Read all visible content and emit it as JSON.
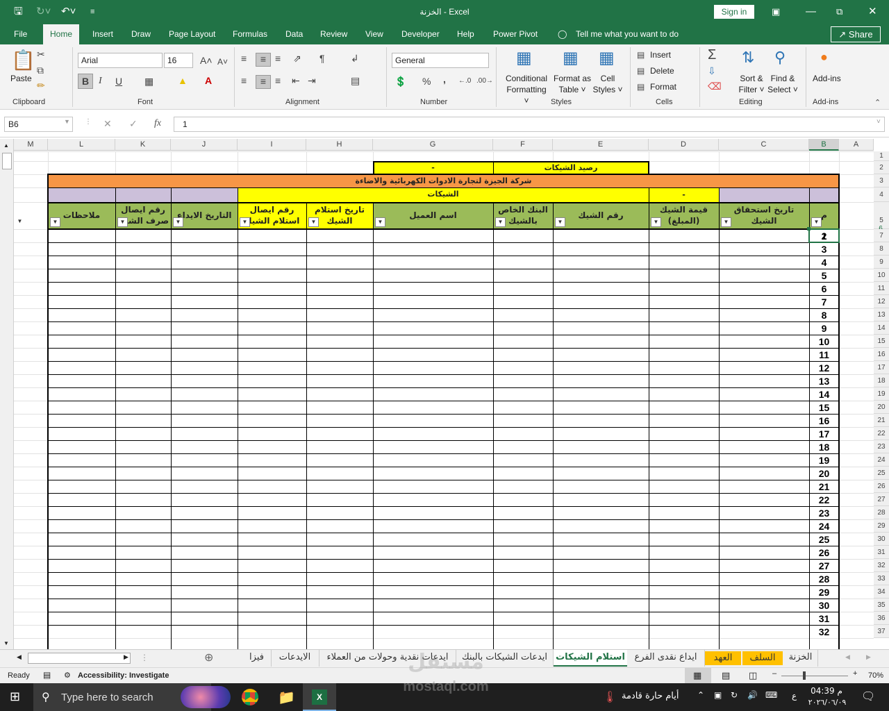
{
  "window": {
    "title": "الخزنة - Excel",
    "sign_in": "Sign in"
  },
  "menu": {
    "tabs": [
      "File",
      "Home",
      "Insert",
      "Draw",
      "Page Layout",
      "Formulas",
      "Data",
      "Review",
      "View",
      "Developer",
      "Help",
      "Power Pivot"
    ],
    "tell_me": "Tell me what you want to do",
    "share": "Share"
  },
  "ribbon": {
    "clipboard": {
      "paste": "Paste",
      "label": "Clipboard"
    },
    "font": {
      "name": "Arial",
      "size": "16",
      "bold": "B",
      "italic": "I",
      "underline": "U",
      "label": "Font"
    },
    "alignment": {
      "label": "Alignment"
    },
    "number": {
      "format": "General",
      "percent": "%",
      "comma": ",",
      "label": "Number"
    },
    "styles": {
      "conditional": [
        "Conditional",
        "Formatting ˅"
      ],
      "format_table": [
        "Format as",
        "Table ˅"
      ],
      "cell_styles": [
        "Cell",
        "Styles ˅"
      ],
      "label": "Styles"
    },
    "cells": {
      "insert": "Insert",
      "delete": "Delete",
      "format": "Format",
      "label": "Cells"
    },
    "editing": {
      "sort": [
        "Sort &",
        "Filter ˅"
      ],
      "find": [
        "Find &",
        "Select ˅"
      ],
      "label": "Editing"
    },
    "addins": {
      "button": "Add-ins",
      "label": "Add-ins"
    }
  },
  "formula_bar": {
    "name_box": "B6",
    "fx": "fx",
    "value": "1"
  },
  "columns": [
    "M",
    "L",
    "K",
    "J",
    "I",
    "H",
    "G",
    "F",
    "E",
    "D",
    "C",
    "B",
    "A"
  ],
  "rows": [
    "1",
    "2",
    "3",
    "4",
    "5",
    "6",
    "7",
    "8",
    "9",
    "10",
    "11",
    "12",
    "13",
    "14",
    "15",
    "16",
    "17",
    "18",
    "19",
    "20",
    "21",
    "22",
    "23",
    "24",
    "25",
    "26",
    "27",
    "28",
    "29",
    "30",
    "31",
    "32",
    "33",
    "34",
    "35",
    "36",
    "37"
  ],
  "sheet": {
    "balance_label": "رصيد الشيكات",
    "balance_value": "-",
    "company": "شركة الجيزة لتجارة الادوات الكهربائية والاضاءة",
    "cheques_title": "الشيكات",
    "total_dash": "-",
    "headers": {
      "b": "م",
      "c": "تاريخ استحقاق الشيك",
      "d": "قيمة الشيك (المبلغ)",
      "e": "رقم الشيك",
      "f": "البنك الخاص بالشيك",
      "g": "اسم العميل",
      "h": "تاريخ استلام الشيك",
      "i": "رقم ايصال استلام الشيك",
      "j": "التاريخ الايداع",
      "k": "رقم ايصال صرف الشيك",
      "l": "ملاحظات"
    },
    "row_numbers": [
      "1",
      "2",
      "3",
      "4",
      "5",
      "6",
      "7",
      "8",
      "9",
      "10",
      "11",
      "12",
      "13",
      "14",
      "15",
      "16",
      "17",
      "18",
      "19",
      "20",
      "21",
      "22",
      "23",
      "24",
      "25",
      "26",
      "27",
      "28",
      "29",
      "30",
      "31",
      "32"
    ]
  },
  "sheet_tabs": [
    "الخزنة",
    "السلف",
    "العهد",
    "ايداع نقدى الفرع",
    "استلام الشيكات",
    "ايدعات الشيكات بالبنك",
    "ايدعات نقدية وحولات من العملاء",
    "الايدعات",
    "فيزا"
  ],
  "active_sheet": "استلام الشيكات",
  "status": {
    "ready": "Ready",
    "accessibility": "Accessibility: Investigate",
    "zoom": "70%"
  },
  "taskbar": {
    "search": "Type here to search",
    "weather": "أيام حارة قادمة",
    "time": "04:39 م",
    "date": "٢٠٢٦/٠٦/٠٩",
    "lang": "ع"
  },
  "watermark": {
    "arabic": "مستقل",
    "latin": "mostaql.com"
  },
  "colors": {
    "excel_green": "#217346",
    "yellow": "#ffff00",
    "orange": "#f79646",
    "green_header": "#9bbb59",
    "lavender": "#ccc0da",
    "tab_yellow": "#ffc000"
  }
}
